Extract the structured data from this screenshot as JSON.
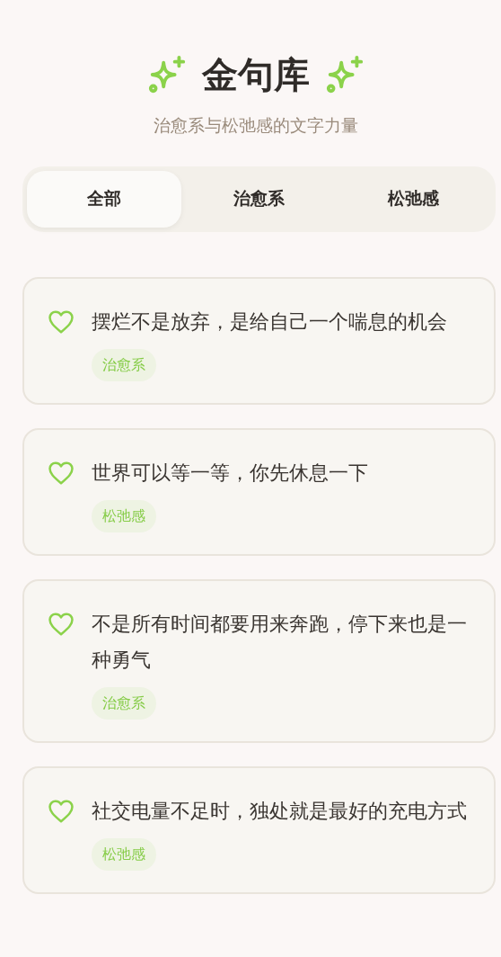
{
  "header": {
    "title": "金句库",
    "subtitle": "治愈系与松弛感的文字力量"
  },
  "tabs": [
    {
      "label": "全部",
      "selected": true
    },
    {
      "label": "治愈系",
      "selected": false
    },
    {
      "label": "松弛感",
      "selected": false
    }
  ],
  "quotes": [
    {
      "text": "摆烂不是放弃，是给自己一个喘息的机会",
      "tag": "治愈系",
      "liked": false
    },
    {
      "text": "世界可以等一等，你先休息一下",
      "tag": "松弛感",
      "liked": false
    },
    {
      "text": "不是所有时间都要用来奔跑，停下来也是一种勇气",
      "tag": "治愈系",
      "liked": false
    },
    {
      "text": "社交电量不足时，独处就是最好的充电方式",
      "tag": "松弛感",
      "liked": false
    }
  ]
}
